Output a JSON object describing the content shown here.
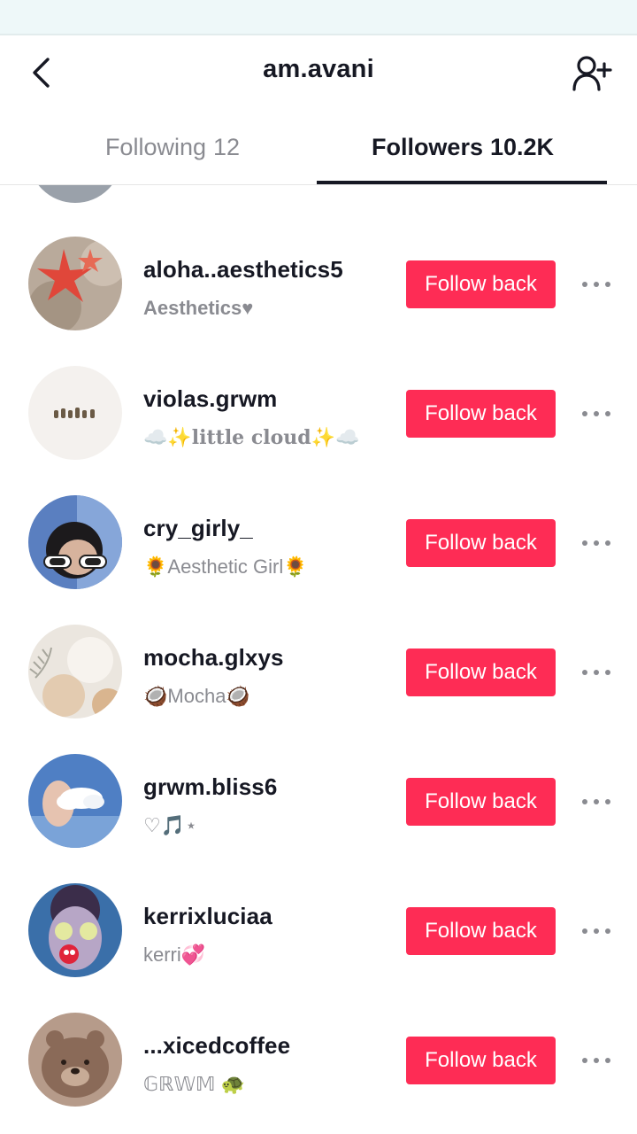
{
  "header": {
    "title": "am.avani",
    "back_icon": "chevron-left-icon",
    "add_icon": "add-person-icon"
  },
  "tabs": [
    {
      "label": "Following",
      "count": "12"
    },
    {
      "label": "Followers",
      "count": "10.2K"
    }
  ],
  "accent_color": "#fe2c55",
  "followers": [
    {
      "username": "aloha..aesthetics5",
      "bio": "Aesthetics♥",
      "button": "Follow back"
    },
    {
      "username": "violas.grwm",
      "bio": "☁️✨little cloud✨☁️",
      "button": "Follow back"
    },
    {
      "username": "cry_girly_",
      "bio": "🌻Aesthetic Girl🌻",
      "button": "Follow back"
    },
    {
      "username": "mocha.glxys",
      "bio": "🥥Mocha🥥",
      "button": "Follow back"
    },
    {
      "username": "grwm.bliss6",
      "bio": "♡🎵⋆",
      "button": "Follow back"
    },
    {
      "username": "kerrixluciaa",
      "bio": "kerri💞",
      "button": "Follow back"
    },
    {
      "username": "...xicedcoffee",
      "bio": "𝔾ℝ𝕎𝕄 🐢",
      "button": "Follow back"
    }
  ]
}
